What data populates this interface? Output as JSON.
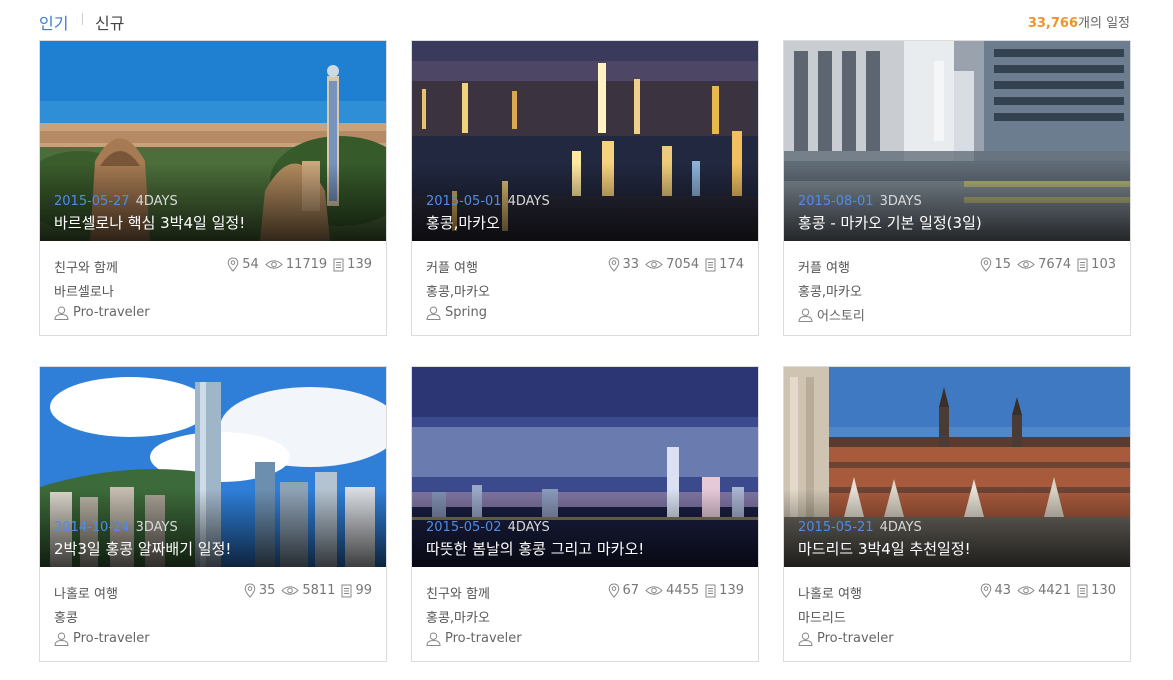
{
  "tabs": {
    "popular": "인기",
    "new": "신규"
  },
  "total": {
    "count": "33,766",
    "suffix": "개의 일정"
  },
  "colors": {
    "accent": "#3a7bd5",
    "date": "#4f8ce6",
    "count": "#f0932b"
  },
  "cards": [
    {
      "date": "2015-05-27",
      "days": "4DAYS",
      "title": "바르셀로나 핵심 3박4일 일정!",
      "theme": "친구와 함께",
      "city": "바르셀로나",
      "author": "Pro-traveler",
      "pins": "54",
      "views": "11719",
      "docs": "139"
    },
    {
      "date": "2015-05-01",
      "days": "4DAYS",
      "title": "홍콩,마카오",
      "theme": "커플 여행",
      "city": "홍콩,마카오",
      "author": "Spring",
      "pins": "33",
      "views": "7054",
      "docs": "174"
    },
    {
      "date": "2015-08-01",
      "days": "3DAYS",
      "title": "홍콩 - 마카오 기본 일정(3일)",
      "theme": "커플 여행",
      "city": "홍콩,마카오",
      "author": "어스토리",
      "pins": "15",
      "views": "7674",
      "docs": "103"
    },
    {
      "date": "2014-10-24",
      "days": "3DAYS",
      "title": "2박3일 홍콩 알짜배기 일정!",
      "theme": "나홀로 여행",
      "city": "홍콩",
      "author": "Pro-traveler",
      "pins": "35",
      "views": "5811",
      "docs": "99"
    },
    {
      "date": "2015-05-02",
      "days": "4DAYS",
      "title": "따뜻한 봄날의 홍콩 그리고 마카오!",
      "theme": "친구와 함께",
      "city": "홍콩,마카오",
      "author": "Pro-traveler",
      "pins": "67",
      "views": "4455",
      "docs": "139"
    },
    {
      "date": "2015-05-21",
      "days": "4DAYS",
      "title": "마드리드 3박4일 추천일정!",
      "theme": "나홀로 여행",
      "city": "마드리드",
      "author": "Pro-traveler",
      "pins": "43",
      "views": "4421",
      "docs": "130"
    }
  ]
}
